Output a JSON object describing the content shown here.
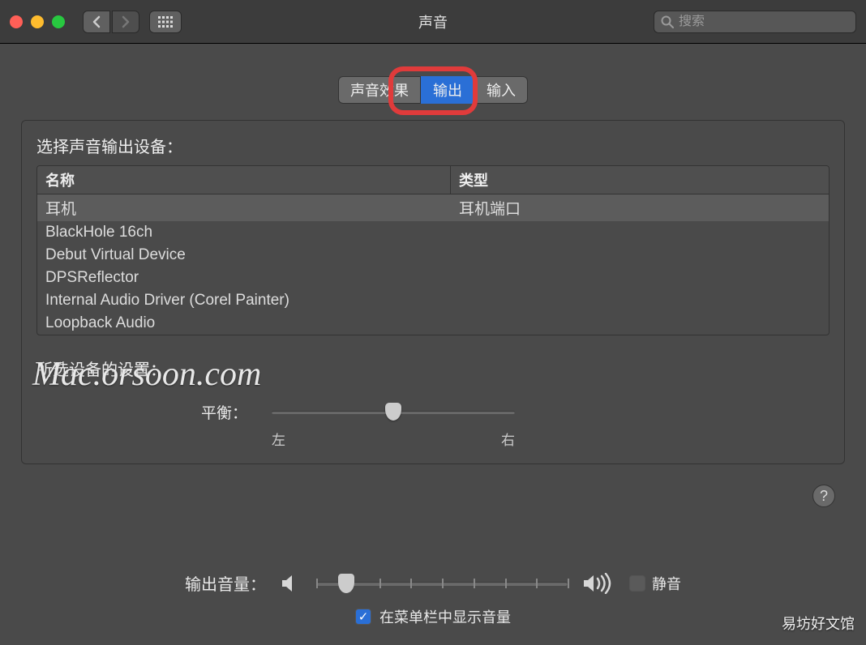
{
  "window": {
    "title": "声音"
  },
  "search": {
    "placeholder": "搜索"
  },
  "tabs": {
    "effects": "声音效果",
    "output": "输出",
    "input": "输入",
    "active": "output"
  },
  "panel": {
    "heading": "选择声音输出设备：",
    "columns": {
      "name": "名称",
      "type": "类型"
    },
    "devices": [
      {
        "name": "耳机",
        "type": "耳机端口",
        "selected": true
      },
      {
        "name": "BlackHole 16ch",
        "type": "",
        "selected": false
      },
      {
        "name": "Debut Virtual Device",
        "type": "",
        "selected": false
      },
      {
        "name": "DPSReflector",
        "type": "",
        "selected": false
      },
      {
        "name": "Internal Audio Driver (Corel Painter)",
        "type": "",
        "selected": false
      },
      {
        "name": "Loopback Audio",
        "type": "",
        "selected": false
      }
    ],
    "settings_heading": "所选设备的设置：",
    "balance": {
      "label": "平衡：",
      "left": "左",
      "right": "右",
      "value": 0.5
    }
  },
  "footer": {
    "volume_label": "输出音量：",
    "volume_value": 0.12,
    "mute_label": "静音",
    "mute_checked": false,
    "menubar_label": "在菜单栏中显示音量",
    "menubar_checked": true
  },
  "icons": {
    "back": "‹",
    "forward": "›",
    "grid": "⊞",
    "help": "?",
    "search": "⌕",
    "check": "✓"
  },
  "watermark": "Mac.orsoon.com",
  "corner_watermark": "易坊好文馆"
}
